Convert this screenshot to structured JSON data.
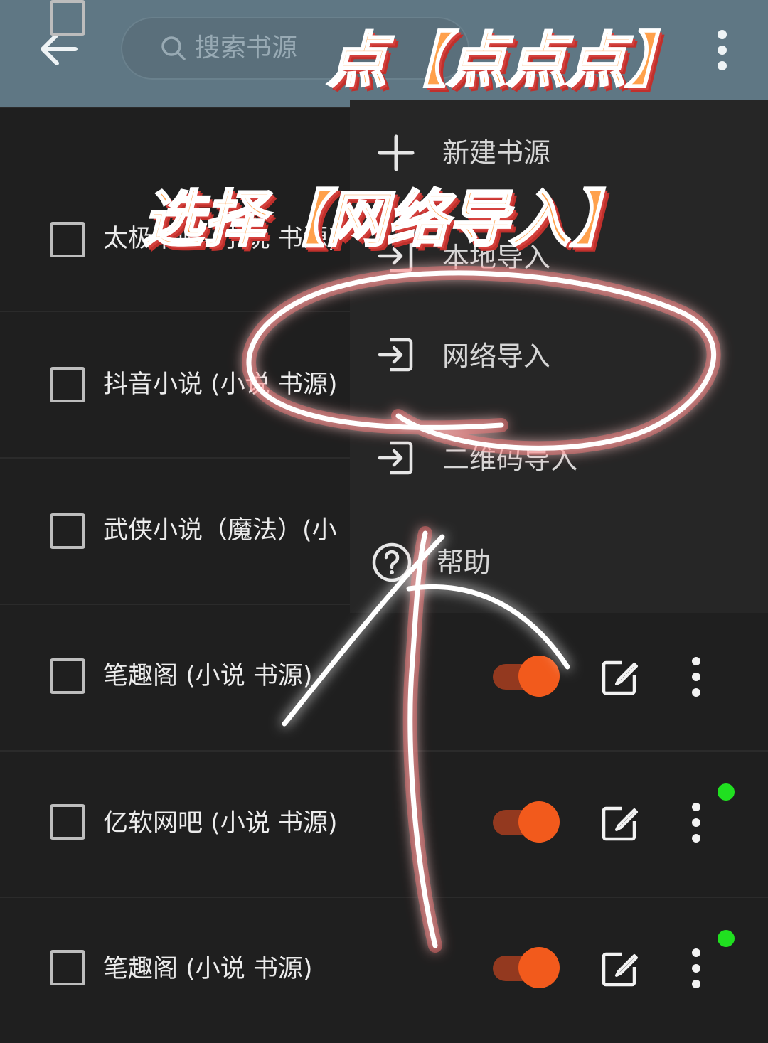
{
  "appbar": {
    "search_placeholder": "搜索书源"
  },
  "annotations": {
    "tap_hint": "点【点点点】",
    "select_hint": "选择【网络导入】"
  },
  "menu": {
    "items": [
      {
        "label": "新建书源",
        "icon": "plus-icon"
      },
      {
        "label": "本地导入",
        "icon": "import-icon"
      },
      {
        "label": "网络导入",
        "icon": "import-icon"
      },
      {
        "label": "二维码导入",
        "icon": "import-icon"
      },
      {
        "label": "帮助",
        "icon": "help-circle-icon"
      }
    ]
  },
  "sources": [
    {
      "label": "太极书吧 (小说 书源)"
    },
    {
      "label": "抖音小说 (小说 书源)"
    },
    {
      "label": "武侠小说（魔法）(小"
    },
    {
      "label": "笔趣阁 (小说 书源)",
      "enabled": true
    },
    {
      "label": "亿软网吧 (小说 书源)",
      "enabled": true
    },
    {
      "label": "笔趣阁 (小说 书源)",
      "enabled": true
    }
  ],
  "colors": {
    "appbar": "#5f7784",
    "toggle_on": "#f25a1c",
    "status_dot": "#20e020",
    "annotation_ink": "#ffffff"
  }
}
